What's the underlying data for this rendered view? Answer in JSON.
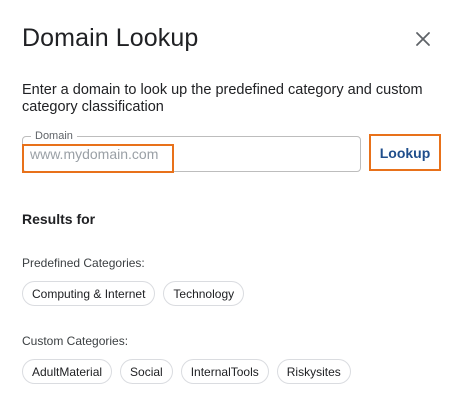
{
  "dialog": {
    "title": "Domain Lookup",
    "close_icon": "close-icon",
    "description": "Enter a domain to look up the predefined category and custom category classification"
  },
  "domain_field": {
    "label": "Domain",
    "placeholder": "www.mydomain.com",
    "value": ""
  },
  "lookup_button": {
    "label": "Lookup"
  },
  "results": {
    "heading": "Results for",
    "predefined_label": "Predefined Categories:",
    "predefined": [
      "Computing & Internet",
      "Technology"
    ],
    "custom_label": "Custom Categories:",
    "custom": [
      "AdultMaterial",
      "Social",
      "InternalTools",
      "Riskysites"
    ]
  },
  "colors": {
    "highlight": "#e8711a",
    "lookup_text": "#1f4e8c",
    "chip_border": "#dadce0"
  }
}
